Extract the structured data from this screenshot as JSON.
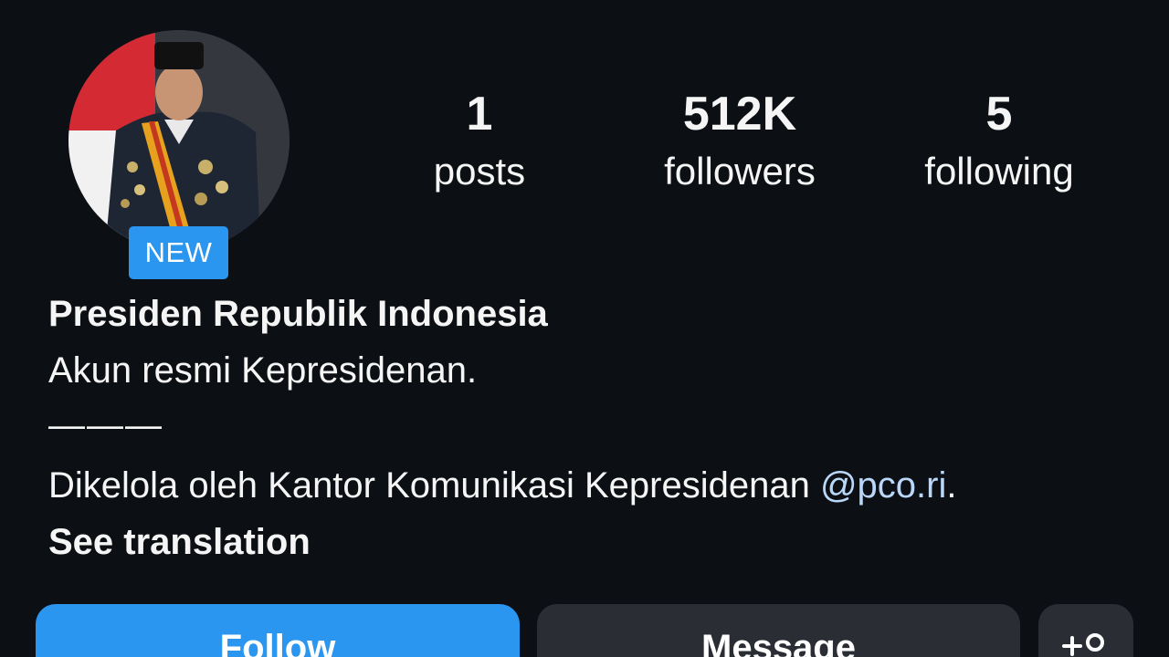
{
  "profile": {
    "new_badge": "NEW",
    "display_name": "Presiden Republik Indonesia",
    "bio_line1": "Akun resmi Kepresidenan.",
    "bio_separator": "———",
    "bio_line2_text": "Dikelola oleh Kantor Komunikasi Kepresidenan ",
    "bio_mention": "@pco.ri",
    "bio_line2_end": ".",
    "see_translation": "See translation"
  },
  "stats": {
    "posts": {
      "value": "1",
      "label": "posts"
    },
    "followers": {
      "value": "512K",
      "label": "followers"
    },
    "following": {
      "value": "5",
      "label": "following"
    }
  },
  "actions": {
    "follow_label": "Follow",
    "message_label": "Message",
    "add_user_icon": "add-user-icon"
  },
  "colors": {
    "background": "#0c0f14",
    "accent_blue": "#2b96f0",
    "secondary_button": "#2a2d33",
    "mention": "#b9d7f8"
  }
}
